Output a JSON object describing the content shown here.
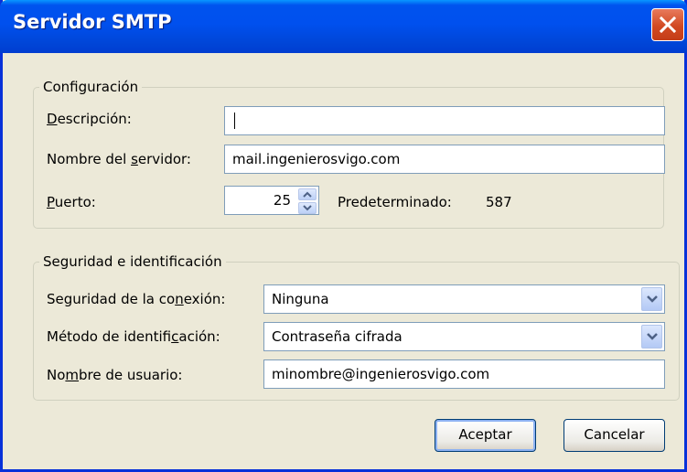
{
  "window": {
    "title": "Servidor SMTP"
  },
  "config": {
    "legend": "Configuración",
    "description": {
      "label": "Descripción:",
      "value": ""
    },
    "server": {
      "label": "Nombre del servidor:",
      "value": "mail.ingenierosvigo.com"
    },
    "port": {
      "label": "Puerto:",
      "value": "25",
      "default_label": "Predeterminado:",
      "default_value": "587"
    }
  },
  "security": {
    "legend": "Seguridad e identificación",
    "connection": {
      "label": "Seguridad de la conexión:",
      "selected": "Ninguna"
    },
    "auth_method": {
      "label": "Método de identificación:",
      "selected": "Contraseña cifrada"
    },
    "username": {
      "label": "Nombre de usuario:",
      "value": "minombre@ingenierosvigo.com"
    }
  },
  "buttons": {
    "accept": "Aceptar",
    "cancel": "Cancelar"
  },
  "icons": {
    "close": "close-icon",
    "spin_up": "chevron-up-icon",
    "spin_down": "chevron-down-icon",
    "dropdown": "chevron-down-icon"
  },
  "colors": {
    "titlebar": "#0053ee",
    "window_bg": "#ece9d8",
    "close_button": "#d24a23",
    "field_border": "#7f9db9"
  }
}
